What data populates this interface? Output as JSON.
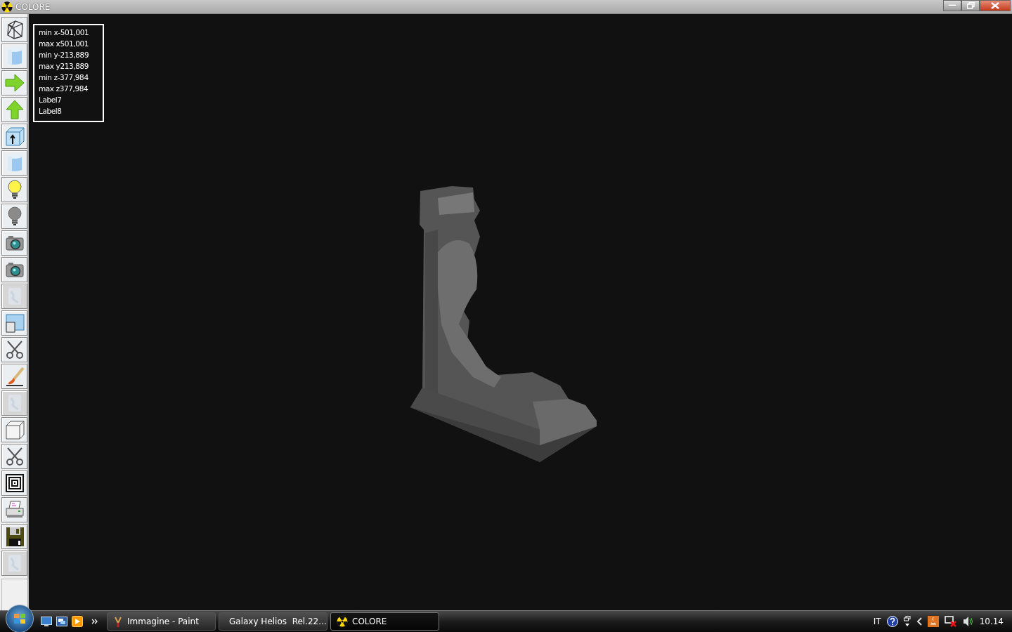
{
  "window": {
    "title": "COLORE"
  },
  "tools": [
    {
      "kind": "wireframe",
      "disabled": false
    },
    {
      "kind": "cylinder",
      "disabled": false
    },
    {
      "kind": "arrow-right",
      "disabled": false
    },
    {
      "kind": "arrow-up",
      "disabled": false
    },
    {
      "kind": "box-arrow",
      "disabled": false
    },
    {
      "kind": "cylinder",
      "disabled": false
    },
    {
      "kind": "bulb-on",
      "disabled": false
    },
    {
      "kind": "bulb-off",
      "disabled": false
    },
    {
      "kind": "camera",
      "disabled": false
    },
    {
      "kind": "camera",
      "disabled": false
    },
    {
      "kind": "blank",
      "disabled": true
    },
    {
      "kind": "windows",
      "disabled": false
    },
    {
      "kind": "scissors",
      "disabled": false
    },
    {
      "kind": "brush",
      "disabled": false
    },
    {
      "kind": "blank",
      "disabled": true
    },
    {
      "kind": "cube",
      "disabled": false
    },
    {
      "kind": "scissors",
      "disabled": false
    },
    {
      "kind": "squares",
      "disabled": false
    },
    {
      "kind": "printer",
      "disabled": false
    },
    {
      "kind": "floppy",
      "disabled": false
    },
    {
      "kind": "blank",
      "disabled": true
    }
  ],
  "info_panel": {
    "lines": [
      "min x-501,001",
      "max x501,001",
      "min y-213,889",
      "max y213,889",
      "min z-377,984",
      "max z377,984",
      "Label7",
      "Label8"
    ]
  },
  "taskbar": {
    "tasks": [
      {
        "label": "Immagine - Paint",
        "kind": "paint",
        "selected": false
      },
      {
        "label": "Galaxy Helios  Rel.22...",
        "kind": "helios",
        "selected": false
      },
      {
        "label": "COLORE",
        "kind": "colore",
        "selected": true
      }
    ],
    "language": "IT",
    "clock": "10.14"
  }
}
